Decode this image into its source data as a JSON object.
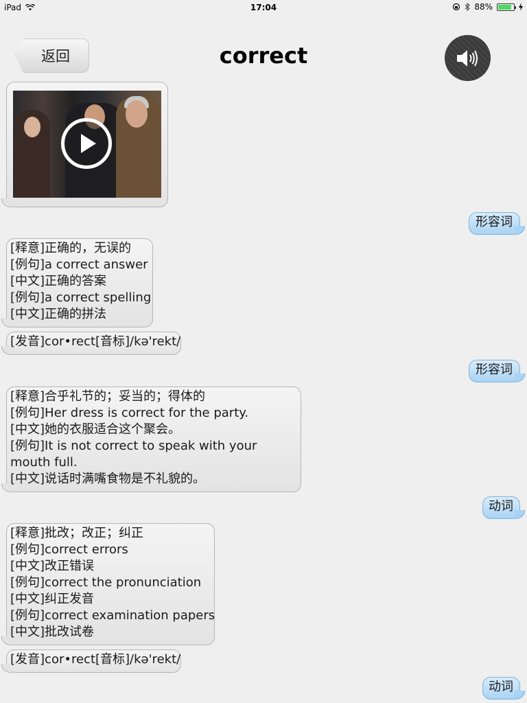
{
  "status_bar": {
    "device": "iPad",
    "time": "17:04",
    "battery": "88%",
    "battery_level": 0.88
  },
  "header": {
    "back_label": "返回",
    "title": "correct"
  },
  "messages": {
    "pos1": "形容词",
    "sense1": [
      "[释意]正确的，无误的",
      "[例句]a correct answer",
      "[中文]正确的答案",
      "[例句]a correct spelling",
      "[中文]正确的拼法"
    ],
    "pron1": "[发音]cor•rect[音标]/kə'rekt/",
    "pos2": "形容词",
    "sense2": [
      "[释意]合乎礼节的；妥当的；得体的",
      "[例句]Her dress is correct for the party.",
      "[中文]她的衣服适合这个聚会。",
      "[例句]It is not correct to speak with your mouth full.",
      "[中文]说话时满嘴食物是不礼貌的。"
    ],
    "pos3": "动词",
    "sense3": [
      "[释意]批改；改正；纠正",
      "[例句]correct errors",
      "[中文]改正错误",
      "[例句]correct the pronunciation",
      "[中文]纠正发音",
      "[例句]correct examination papers",
      "[中文]批改试卷"
    ],
    "pron2": "[发音]cor•rect[音标]/kə'rekt/",
    "pos4": "动词"
  },
  "icons": {
    "sound": "speaker-icon",
    "play": "play-icon"
  },
  "colors": {
    "right_bubble": "#a9d3f4",
    "left_bubble": "#e3e3e3",
    "sound_button": "#3a3a3a"
  }
}
